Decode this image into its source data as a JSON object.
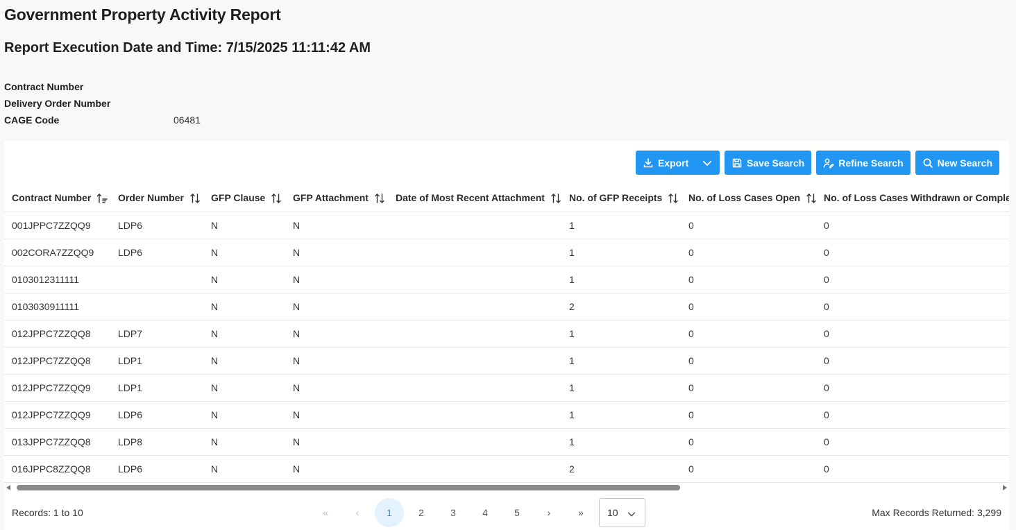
{
  "report": {
    "title": "Government Property Activity Report",
    "execution": "Report Execution Date and Time: 7/15/2025 11:11:42 AM"
  },
  "criteria": [
    {
      "label": "Contract Number",
      "value": ""
    },
    {
      "label": "Delivery Order Number",
      "value": ""
    },
    {
      "label": "CAGE Code",
      "value": "06481"
    }
  ],
  "toolbar": {
    "export_label": "Export",
    "save_search_label": "Save Search",
    "refine_search_label": "Refine Search",
    "new_search_label": "New Search",
    "accent_color": "#2196f3"
  },
  "table": {
    "columns": [
      "Contract Number",
      "Order Number",
      "GFP Clause",
      "GFP Attachment",
      "Date of Most Recent Attachment",
      "No. of GFP Receipts",
      "No. of Loss Cases Open",
      "No. of Loss Cases Withdrawn or Completed"
    ],
    "sorted_column": "Contract Number",
    "rows": [
      [
        "001JPPC7ZZQQ9",
        "LDP6",
        "N",
        "N",
        "",
        "1",
        "0",
        "0"
      ],
      [
        "002CORA7ZZQQ9",
        "LDP6",
        "N",
        "N",
        "",
        "1",
        "0",
        "0"
      ],
      [
        "0103012311111",
        "",
        "N",
        "N",
        "",
        "1",
        "0",
        "0"
      ],
      [
        "0103030911111",
        "",
        "N",
        "N",
        "",
        "2",
        "0",
        "0"
      ],
      [
        "012JPPC7ZZQQ8",
        "LDP7",
        "N",
        "N",
        "",
        "1",
        "0",
        "0"
      ],
      [
        "012JPPC7ZZQQ8",
        "LDP1",
        "N",
        "N",
        "",
        "1",
        "0",
        "0"
      ],
      [
        "012JPPC7ZZQQ9",
        "LDP1",
        "N",
        "N",
        "",
        "1",
        "0",
        "0"
      ],
      [
        "012JPPC7ZZQQ9",
        "LDP6",
        "N",
        "N",
        "",
        "1",
        "0",
        "0"
      ],
      [
        "013JPPC7ZZQQ8",
        "LDP8",
        "N",
        "N",
        "",
        "1",
        "0",
        "0"
      ],
      [
        "016JPPC8ZZQQ8",
        "LDP6",
        "N",
        "N",
        "",
        "2",
        "0",
        "0"
      ]
    ]
  },
  "footer": {
    "records_label": "Records: 1 to 10",
    "max_records_label": "Max Records Returned: 3,299",
    "first_glyph": "«",
    "prev_glyph": "‹",
    "next_glyph": "›",
    "last_glyph": "»",
    "pages": [
      "1",
      "2",
      "3",
      "4",
      "5"
    ],
    "current_page": "1",
    "page_size": "10"
  }
}
